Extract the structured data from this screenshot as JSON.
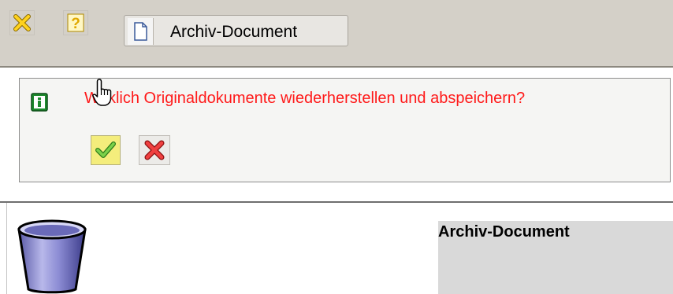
{
  "toolbar": {
    "close_icon": "close-x-icon",
    "help_icon": "question-mark-icon",
    "tab": {
      "icon": "document-icon",
      "label": "Archiv-Document"
    }
  },
  "dialog": {
    "info_icon": "info-icon",
    "message": "Wirklich Originaldokumente wiederherstellen und abspeichern?",
    "confirm_icon": "checkmark-icon",
    "cancel_icon": "close-x-icon",
    "message_color": "#ff1a1a",
    "confirm_bg": "#f4ed7c"
  },
  "content": {
    "trash_icon": "trash-bin-icon",
    "panel_title": "Archiv-Document"
  }
}
